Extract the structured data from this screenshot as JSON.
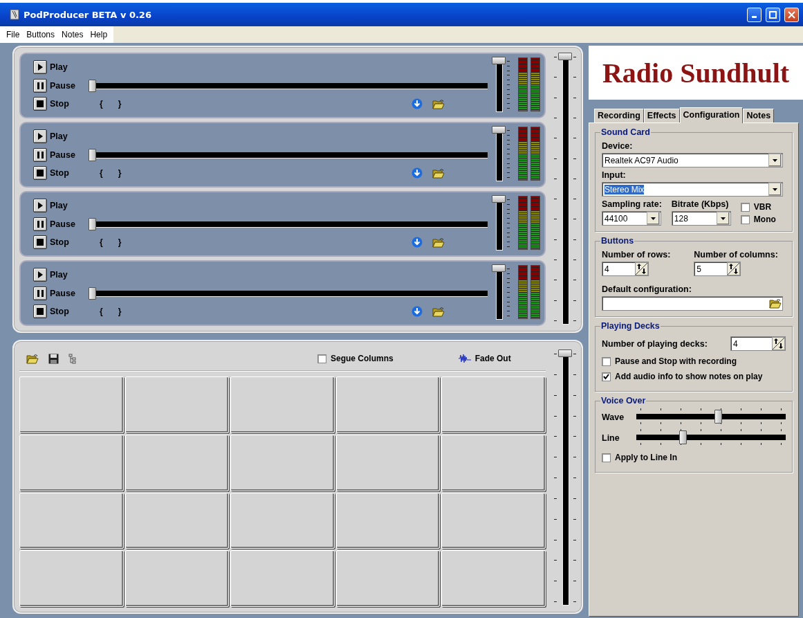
{
  "window": {
    "title": "PodProducer BETA v 0.26"
  },
  "menu": [
    "File",
    "Buttons",
    "Notes",
    "Help"
  ],
  "decks": [
    {
      "play": "Play",
      "pause": "Pause",
      "stop": "Stop",
      "brace_open": "{",
      "brace_close": "}",
      "position": {
        "level": 0
      },
      "volume": {
        "level": 1
      }
    },
    {
      "play": "Play",
      "pause": "Pause",
      "stop": "Stop",
      "brace_open": "{",
      "brace_close": "}",
      "position": {
        "level": 0
      },
      "volume": {
        "level": 1
      }
    },
    {
      "play": "Play",
      "pause": "Pause",
      "stop": "Stop",
      "brace_open": "{",
      "brace_close": "}",
      "position": {
        "level": 0
      },
      "volume": {
        "level": 1
      }
    },
    {
      "play": "Play",
      "pause": "Pause",
      "stop": "Stop",
      "brace_open": "{",
      "brace_close": "}",
      "position": {
        "level": 0
      },
      "volume": {
        "level": 1
      }
    }
  ],
  "master_volume": {
    "level": 1
  },
  "button_board": {
    "segue": {
      "label": "Segue Columns",
      "checked": false
    },
    "fade_out": "Fade Out",
    "volume": {
      "level": 1
    }
  },
  "logo": {
    "text": "Radio Sundhult"
  },
  "tabs": [
    {
      "label": "Recording",
      "selected": false
    },
    {
      "label": "Effects",
      "selected": false
    },
    {
      "label": "Configuration",
      "selected": true
    },
    {
      "label": "Notes",
      "selected": false
    }
  ],
  "sound_card": {
    "title": "Sound Card",
    "device": {
      "label": "Device:",
      "value": "Realtek AC97 Audio",
      "text_selected": false
    },
    "input": {
      "label": "Input:",
      "value": "Stereo Mix",
      "text_selected": true
    },
    "sampling_rate": {
      "label": "Sampling rate:",
      "value": "44100"
    },
    "bitrate": {
      "label": "Bitrate (Kbps)",
      "value": "128"
    },
    "vbr": {
      "label": "VBR",
      "checked": false
    },
    "mono": {
      "label": "Mono",
      "checked": false
    }
  },
  "buttons_group": {
    "title": "Buttons",
    "rows": {
      "label": "Number of rows:",
      "value": "4"
    },
    "columns": {
      "label": "Number of columns:",
      "value": "5"
    },
    "default_configuration": {
      "label": "Default configuration:"
    }
  },
  "playing_decks": {
    "title": "Playing Decks",
    "count": {
      "label": "Number of playing decks:",
      "value": "4"
    },
    "pause_stop": {
      "label": "Pause and Stop with recording",
      "checked": false
    },
    "audio_info": {
      "label": "Add audio info to show notes on play",
      "checked": true
    }
  },
  "voice_over": {
    "title": "Voice Over",
    "wave": {
      "label": "Wave",
      "level": 0.55
    },
    "line": {
      "label": "Line",
      "level": 0.3
    },
    "apply_line_in": {
      "label": "Apply to Line In",
      "checked": false
    }
  }
}
